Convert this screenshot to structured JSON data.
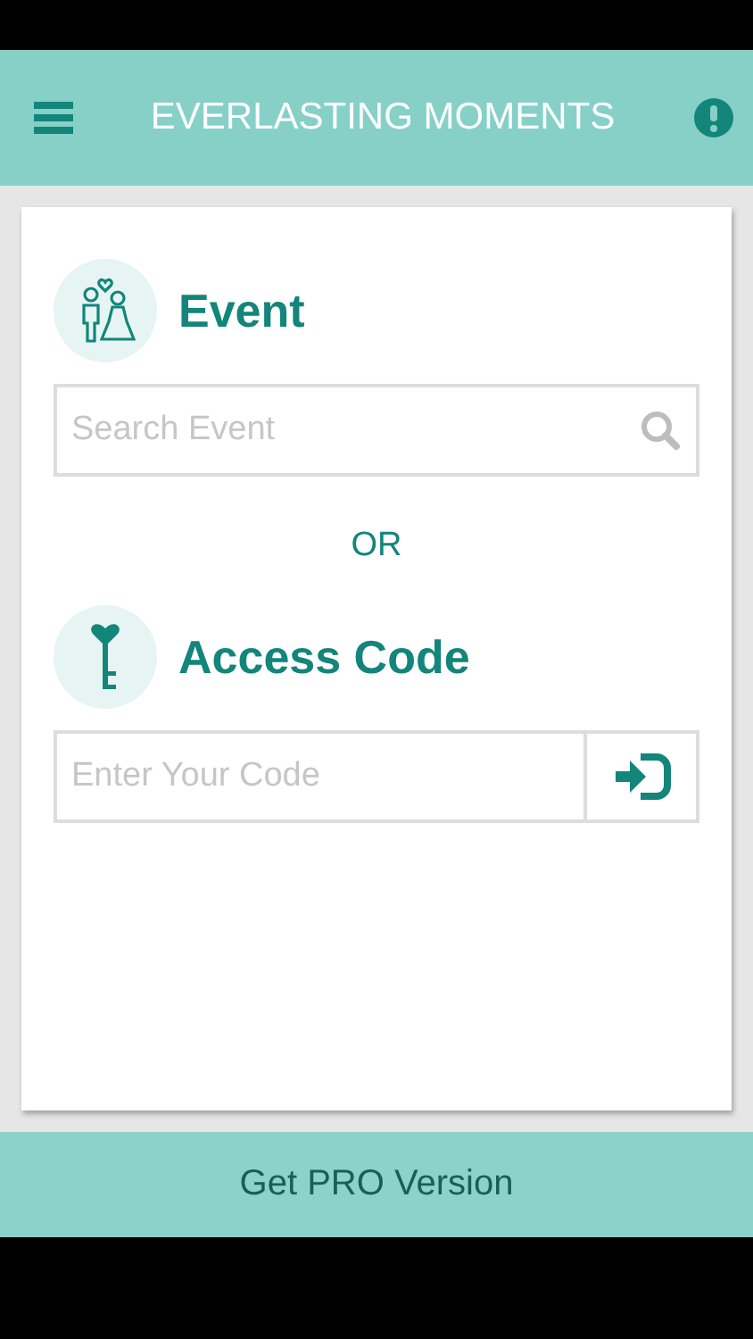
{
  "app_bar": {
    "title": "EVERLASTING MOMENTS"
  },
  "event": {
    "heading": "Event",
    "search": {
      "placeholder": "Search Event"
    }
  },
  "separator": "OR",
  "access_code": {
    "heading": "Access Code",
    "field": {
      "placeholder": "Enter Your Code"
    }
  },
  "footer": {
    "label": "Get PRO Version"
  }
}
